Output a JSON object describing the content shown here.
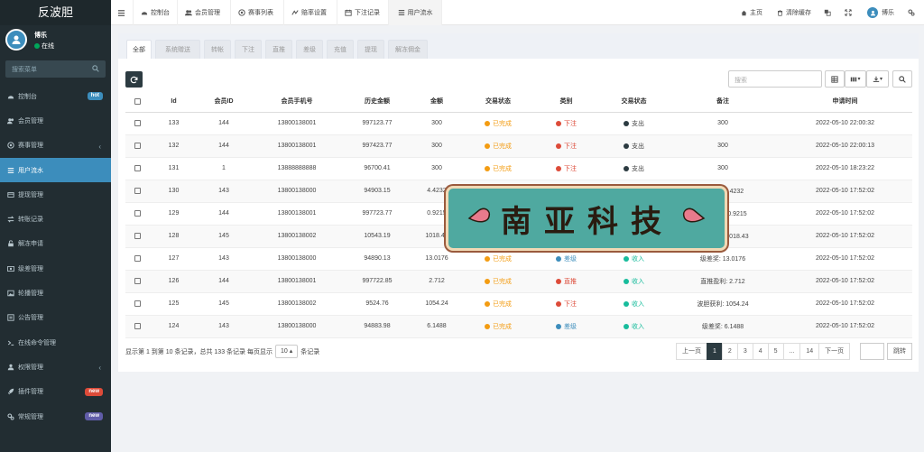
{
  "app": {
    "logo": "反波胆"
  },
  "user": {
    "name": "博乐",
    "status": "在线"
  },
  "sidebar": {
    "search_placeholder": "搜索菜单",
    "items": [
      {
        "label": "控制台",
        "icon": "dashboard-icon",
        "badge": "hot",
        "badge_color": "#3c8dbc"
      },
      {
        "label": "会员管理",
        "icon": "users-icon"
      },
      {
        "label": "赛事管理",
        "icon": "soccer-icon",
        "chevron": "‹"
      },
      {
        "label": "用户流水",
        "icon": "list-icon",
        "active": true
      },
      {
        "label": "提现管理",
        "icon": "withdraw-icon"
      },
      {
        "label": "转账记录",
        "icon": "transfer-icon"
      },
      {
        "label": "解冻申请",
        "icon": "unlock-icon"
      },
      {
        "label": "级差管理",
        "icon": "money-icon"
      },
      {
        "label": "轮播管理",
        "icon": "image-icon"
      },
      {
        "label": "公告管理",
        "icon": "notice-icon"
      },
      {
        "label": "在线命令管理",
        "icon": "terminal-icon"
      },
      {
        "label": "权限管理",
        "icon": "group-icon",
        "chevron": "‹"
      },
      {
        "label": "插件管理",
        "icon": "rocket-icon",
        "badge": "new",
        "badge_color": "#dd4b39"
      },
      {
        "label": "常规管理",
        "icon": "cogs-icon",
        "badge": "new",
        "badge_color": "#605ca8"
      }
    ]
  },
  "topbar": {
    "tabs": [
      "控制台",
      "会员管理",
      "赛事列表",
      "赔率设置",
      "下注记录",
      "用户流水"
    ],
    "right": [
      "主页",
      "清除缓存"
    ],
    "user_name": "博乐"
  },
  "subtabs": [
    "全部",
    "系统赠送",
    "转帐",
    "下注",
    "直推",
    "差级",
    "充值",
    "提现",
    "解冻佣金"
  ],
  "toolbar": {
    "search_placeholder": "搜索"
  },
  "table": {
    "headers": [
      "Id",
      "会员ID",
      "会员手机号",
      "历史金额",
      "金额",
      "交易状态",
      "类别",
      "交易状态",
      "备注",
      "申请时间"
    ],
    "rows": [
      {
        "id": "133",
        "uid": "144",
        "phone": "13800138001",
        "history": "997123.77",
        "amount": "300",
        "status": "已完成",
        "category": "下注",
        "cat_color": "#dd4b39",
        "direction": "支出",
        "dir_color": "#2c3b41",
        "remark": "300",
        "time": "2022-05-10 22:00:32"
      },
      {
        "id": "132",
        "uid": "144",
        "phone": "13800138001",
        "history": "997423.77",
        "amount": "300",
        "status": "已完成",
        "category": "下注",
        "cat_color": "#dd4b39",
        "direction": "支出",
        "dir_color": "#2c3b41",
        "remark": "300",
        "time": "2022-05-10 22:00:13"
      },
      {
        "id": "131",
        "uid": "1",
        "phone": "13888888888",
        "history": "96700.41",
        "amount": "300",
        "status": "已完成",
        "category": "下注",
        "cat_color": "#dd4b39",
        "direction": "支出",
        "dir_color": "#2c3b41",
        "remark": "300",
        "time": "2022-05-10 18:23:22"
      },
      {
        "id": "130",
        "uid": "143",
        "phone": "13800138000",
        "history": "94903.15",
        "amount": "4.4232",
        "status": "已完成",
        "category": "差级",
        "cat_color": "#3c8dbc",
        "direction": "收入",
        "dir_color": "#18bc9c",
        "remark": "级差奖: 4.4232",
        "time": "2022-05-10 17:52:02"
      },
      {
        "id": "129",
        "uid": "144",
        "phone": "13800138001",
        "history": "997723.77",
        "amount": "0.9215",
        "status": "已完成",
        "category": "直推",
        "cat_color": "#dd4b39",
        "direction": "收入",
        "dir_color": "#18bc9c",
        "remark": "直推盈利: 0.9215",
        "time": "2022-05-10 17:52:02"
      },
      {
        "id": "128",
        "uid": "145",
        "phone": "13800138002",
        "history": "10543.19",
        "amount": "1018.43",
        "status": "已完成",
        "category": "下注",
        "cat_color": "#dd4b39",
        "direction": "收入",
        "dir_color": "#18bc9c",
        "remark": "波胆获利: 1018.43",
        "time": "2022-05-10 17:52:02"
      },
      {
        "id": "127",
        "uid": "143",
        "phone": "13800138000",
        "history": "94890.13",
        "amount": "13.0176",
        "status": "已完成",
        "category": "差级",
        "cat_color": "#3c8dbc",
        "direction": "收入",
        "dir_color": "#18bc9c",
        "remark": "级差奖: 13.0176",
        "time": "2022-05-10 17:52:02"
      },
      {
        "id": "126",
        "uid": "144",
        "phone": "13800138001",
        "history": "997722.85",
        "amount": "2.712",
        "status": "已完成",
        "category": "直推",
        "cat_color": "#dd4b39",
        "direction": "收入",
        "dir_color": "#18bc9c",
        "remark": "直推盈利: 2.712",
        "time": "2022-05-10 17:52:02"
      },
      {
        "id": "125",
        "uid": "145",
        "phone": "13800138002",
        "history": "9524.76",
        "amount": "1054.24",
        "status": "已完成",
        "category": "下注",
        "cat_color": "#dd4b39",
        "direction": "收入",
        "dir_color": "#18bc9c",
        "remark": "波胆获利: 1054.24",
        "time": "2022-05-10 17:52:02"
      },
      {
        "id": "124",
        "uid": "143",
        "phone": "13800138000",
        "history": "94883.98",
        "amount": "6.1488",
        "status": "已完成",
        "category": "差级",
        "cat_color": "#3c8dbc",
        "direction": "收入",
        "dir_color": "#18bc9c",
        "remark": "级差奖: 6.1488",
        "time": "2022-05-10 17:52:02"
      }
    ]
  },
  "pagination": {
    "info_prefix": "显示第 1 到第 10 条记录，总共 133 条记录 每页显示",
    "page_size": "10",
    "info_suffix": "条记录",
    "prev": "上一页",
    "pages": [
      "1",
      "2",
      "3",
      "4",
      "5",
      "...",
      "14"
    ],
    "next": "下一页",
    "jump": "跳转"
  },
  "watermark": "南亚科技",
  "colors": {
    "status_done": "#f39c12",
    "accent": "#3c8dbc",
    "sidebar_bg": "#222d32"
  }
}
